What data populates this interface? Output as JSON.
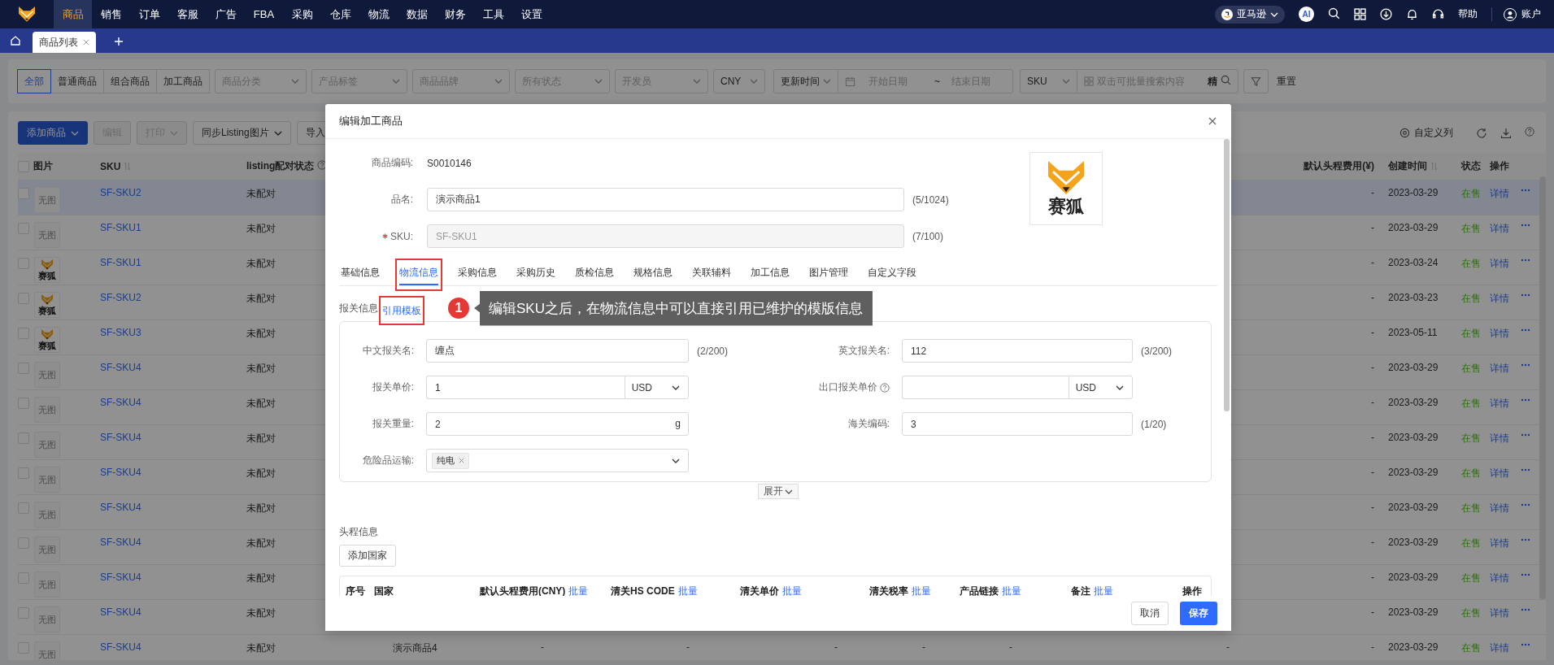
{
  "top_nav": {
    "items": [
      {
        "label": "商品",
        "selected": true
      },
      {
        "label": "销售",
        "selected": false
      },
      {
        "label": "订单",
        "selected": false
      },
      {
        "label": "客服",
        "selected": false
      },
      {
        "label": "广告",
        "selected": false
      },
      {
        "label": "FBA",
        "selected": false
      },
      {
        "label": "采购",
        "selected": false
      },
      {
        "label": "仓库",
        "selected": false
      },
      {
        "label": "物流",
        "selected": false
      },
      {
        "label": "数据",
        "selected": false
      },
      {
        "label": "财务",
        "selected": false
      },
      {
        "label": "工具",
        "selected": false
      },
      {
        "label": "设置",
        "selected": false
      }
    ],
    "marketplace": "亚马逊",
    "ai_badge": "AI",
    "help": "帮助",
    "account": "账户"
  },
  "page_tabs": [
    {
      "label": "商品列表",
      "selected": true
    }
  ],
  "filters": {
    "product_types": [
      {
        "label": "全部",
        "selected": true
      },
      {
        "label": "普通商品",
        "selected": false
      },
      {
        "label": "组合商品",
        "selected": false
      },
      {
        "label": "加工商品",
        "selected": false
      }
    ],
    "selects": [
      {
        "placeholder": "商品分类"
      },
      {
        "placeholder": "产品标签"
      },
      {
        "placeholder": "商品品牌"
      },
      {
        "placeholder": "所有状态"
      },
      {
        "placeholder": "开发员"
      },
      {
        "value": "CNY"
      }
    ],
    "date_type": "更新时间",
    "date_start": {
      "placeholder": "开始日期"
    },
    "date_separator": "~",
    "date_end": {
      "placeholder": "结束日期"
    },
    "search_field": "SKU",
    "search": {
      "placeholder": "双击可批量搜索内容"
    },
    "exact_toggle": "精",
    "reset": "重置"
  },
  "toolbar": {
    "buttons": [
      {
        "label": "添加商品",
        "kind": "primary",
        "dropdown": true,
        "disabled": false
      },
      {
        "label": "编辑",
        "kind": "default",
        "dropdown": false,
        "disabled": true
      },
      {
        "label": "打印",
        "kind": "default",
        "dropdown": true,
        "disabled": true
      },
      {
        "label": "同步Listing图片",
        "kind": "default",
        "dropdown": true,
        "disabled": false
      },
      {
        "label": "导入",
        "kind": "default",
        "dropdown": false,
        "disabled": false
      }
    ],
    "custom_columns": "自定义列"
  },
  "table": {
    "select_all_checked": false,
    "columns": [
      {
        "label": "图片",
        "sortable": false,
        "help": false
      },
      {
        "label": "SKU",
        "sortable": true,
        "help": false
      },
      {
        "label": "listing配对状态",
        "sortable": false,
        "help": true
      },
      {
        "label": "默认头程费用(¥)",
        "sortable": false,
        "help": false
      },
      {
        "label": "创建时间",
        "sortable": true,
        "help": false
      },
      {
        "label": "状态",
        "sortable": false,
        "help": false
      },
      {
        "label": "操作",
        "sortable": false,
        "help": false
      }
    ],
    "rows": [
      {
        "selected": true,
        "image": {
          "kind": "none",
          "text": "无图"
        },
        "sku": "SF-SKU2",
        "listing": "未配对",
        "cost": "-",
        "created": "2023-03-29",
        "status": "在售",
        "action": "详情"
      },
      {
        "selected": false,
        "image": {
          "kind": "none",
          "text": "无图"
        },
        "sku": "SF-SKU1",
        "listing": "未配对",
        "cost": "-",
        "created": "2023-03-29",
        "status": "在售",
        "action": "详情"
      },
      {
        "selected": false,
        "image": {
          "kind": "logo",
          "text": "赛狐"
        },
        "sku": "SF-SKU1",
        "listing": "未配对",
        "cost": "-",
        "created": "2023-03-24",
        "status": "在售",
        "action": "详情"
      },
      {
        "selected": false,
        "image": {
          "kind": "logo",
          "text": "赛狐"
        },
        "sku": "SF-SKU2",
        "listing": "未配对",
        "cost": "-",
        "created": "2023-03-23",
        "status": "在售",
        "action": "详情"
      },
      {
        "selected": false,
        "image": {
          "kind": "logo",
          "text": "赛狐"
        },
        "sku": "SF-SKU3",
        "listing": "未配对",
        "cost": "-",
        "created": "2023-05-11",
        "status": "在售",
        "action": "详情"
      },
      {
        "selected": false,
        "image": {
          "kind": "none",
          "text": "无图"
        },
        "sku": "SF-SKU4",
        "listing": "未配对",
        "cost": "-",
        "created": "2023-03-29",
        "status": "在售",
        "action": "详情"
      },
      {
        "selected": false,
        "image": {
          "kind": "none",
          "text": "无图"
        },
        "sku": "SF-SKU4",
        "listing": "未配对",
        "cost": "-",
        "created": "2023-03-29",
        "status": "在售",
        "action": "详情"
      },
      {
        "selected": false,
        "image": {
          "kind": "none",
          "text": "无图"
        },
        "sku": "SF-SKU4",
        "listing": "未配对",
        "cost": "-",
        "created": "2023-03-29",
        "status": "在售",
        "action": "详情"
      },
      {
        "selected": false,
        "image": {
          "kind": "none",
          "text": "无图"
        },
        "sku": "SF-SKU4",
        "listing": "未配对",
        "cost": "-",
        "created": "2023-03-29",
        "status": "在售",
        "action": "详情"
      },
      {
        "selected": false,
        "image": {
          "kind": "none",
          "text": "无图"
        },
        "sku": "SF-SKU4",
        "listing": "未配对",
        "cost": "-",
        "created": "2023-03-29",
        "status": "在售",
        "action": "详情"
      },
      {
        "selected": false,
        "image": {
          "kind": "none",
          "text": "无图"
        },
        "sku": "SF-SKU4",
        "listing": "未配对",
        "cost": "-",
        "created": "2023-03-29",
        "status": "在售",
        "action": "详情"
      },
      {
        "selected": false,
        "image": {
          "kind": "none",
          "text": "无图"
        },
        "sku": "SF-SKU4",
        "listing": "未配对",
        "cost": "-",
        "created": "2023-03-29",
        "status": "在售",
        "action": "详情"
      },
      {
        "selected": false,
        "image": {
          "kind": "none",
          "text": "无图"
        },
        "sku": "SF-SKU4",
        "listing": "未配对",
        "cost": "-",
        "created": "2023-03-29",
        "status": "在售",
        "action": "详情"
      },
      {
        "selected": false,
        "image": {
          "kind": "none",
          "text": "无图"
        },
        "sku": "SF-SKU4",
        "listing": "未配对",
        "cells": [
          "演示商品4",
          "-",
          "-",
          "-",
          "-",
          "-",
          "-"
        ],
        "cost": "-",
        "created": "2023-03-29",
        "status": "在售",
        "action": "详情"
      }
    ]
  },
  "modal": {
    "title": "编辑加工商品",
    "fields": [
      {
        "label": "商品编码:",
        "kind": "text",
        "value": "S0010146"
      },
      {
        "label": "品名:",
        "kind": "input",
        "value": "演示商品1",
        "counter": "(5/1024)"
      },
      {
        "label": "SKU:",
        "kind": "input",
        "required": true,
        "disabled": true,
        "value": "SF-SKU1",
        "counter": "(7/100)"
      }
    ],
    "product_image": {
      "text": "赛狐"
    },
    "tabs": [
      {
        "label": "基础信息",
        "selected": false,
        "highlighted": false
      },
      {
        "label": "物流信息",
        "selected": true,
        "highlighted": true
      },
      {
        "label": "采购信息",
        "selected": false,
        "highlighted": false
      },
      {
        "label": "采购历史",
        "selected": false,
        "highlighted": false
      },
      {
        "label": "质检信息",
        "selected": false,
        "highlighted": false
      },
      {
        "label": "规格信息",
        "selected": false,
        "highlighted": false
      },
      {
        "label": "关联辅料",
        "selected": false,
        "highlighted": false
      },
      {
        "label": "加工信息",
        "selected": false,
        "highlighted": false
      },
      {
        "label": "图片管理",
        "selected": false,
        "highlighted": false
      },
      {
        "label": "自定义字段",
        "selected": false,
        "highlighted": false
      }
    ],
    "customs": {
      "title": "报关信息",
      "template_link": {
        "label": "引用模板",
        "highlighted": true
      },
      "fields": [
        {
          "label": "中文报关名:",
          "kind": "input",
          "value": "缠点",
          "counter": "(2/200)"
        },
        {
          "label": "英文报关名:",
          "kind": "input",
          "value": "112",
          "counter": "(3/200)"
        },
        {
          "label": "报关单价:",
          "kind": "currency",
          "value": "1",
          "currency": "USD"
        },
        {
          "label": "出口报关单价",
          "kind": "currency",
          "help": true,
          "currency": "USD"
        },
        {
          "label": "报关重量:",
          "kind": "unit",
          "value": "2",
          "unit": "g"
        },
        {
          "label": "海关编码:",
          "kind": "input",
          "value": "3",
          "counter": "(1/20)"
        },
        {
          "label": "危险品运输:",
          "kind": "tags",
          "tags": [
            "纯电"
          ]
        }
      ],
      "expand": "展开"
    },
    "callout": {
      "number": "1",
      "text": "编辑SKU之后，在物流信息中可以直接引用已维护的模版信息"
    },
    "first_leg": {
      "title": "头程信息",
      "add_button": "添加国家",
      "columns": [
        {
          "label": "序号"
        },
        {
          "label": "国家"
        },
        {
          "label": "默认头程费用(CNY)",
          "batch": "批量"
        },
        {
          "label": "清关HS CODE",
          "batch": "批量"
        },
        {
          "label": "清关单价",
          "batch": "批量"
        },
        {
          "label": "清关税率",
          "batch": "批量"
        },
        {
          "label": "产品链接",
          "batch": "批量"
        },
        {
          "label": "备注",
          "batch": "批量"
        },
        {
          "label": "操作"
        }
      ]
    },
    "footer": {
      "cancel": "取消",
      "save": "保存"
    }
  }
}
